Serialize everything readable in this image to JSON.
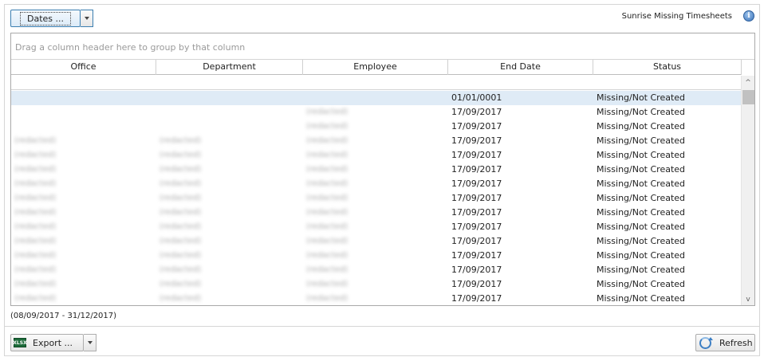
{
  "toolbar": {
    "dates_label": "Dates ...",
    "report_title": "Sunrise Missing Timesheets",
    "info_glyph": "i"
  },
  "grid": {
    "group_panel_hint": "Drag a column header here to group by that column",
    "columns": [
      "Office",
      "Department",
      "Employee",
      "End Date",
      "Status"
    ],
    "rows": [
      {
        "office": "",
        "department": "",
        "employee": "",
        "end_date": "01/01/0001",
        "status": "Missing/Not Created"
      },
      {
        "office": "",
        "department": "",
        "employee": "(redacted)",
        "end_date": "17/09/2017",
        "status": "Missing/Not Created"
      },
      {
        "office": "",
        "department": "",
        "employee": "(redacted)",
        "end_date": "17/09/2017",
        "status": "Missing/Not Created"
      },
      {
        "office": "(redacted)",
        "department": "(redacted)",
        "employee": "(redacted)",
        "end_date": "17/09/2017",
        "status": "Missing/Not Created"
      },
      {
        "office": "(redacted)",
        "department": "(redacted)",
        "employee": "(redacted)",
        "end_date": "17/09/2017",
        "status": "Missing/Not Created"
      },
      {
        "office": "(redacted)",
        "department": "(redacted)",
        "employee": "(redacted)",
        "end_date": "17/09/2017",
        "status": "Missing/Not Created"
      },
      {
        "office": "(redacted)",
        "department": "(redacted)",
        "employee": "(redacted)",
        "end_date": "17/09/2017",
        "status": "Missing/Not Created"
      },
      {
        "office": "(redacted)",
        "department": "(redacted)",
        "employee": "(redacted)",
        "end_date": "17/09/2017",
        "status": "Missing/Not Created"
      },
      {
        "office": "(redacted)",
        "department": "(redacted)",
        "employee": "(redacted)",
        "end_date": "17/09/2017",
        "status": "Missing/Not Created"
      },
      {
        "office": "(redacted)",
        "department": "(redacted)",
        "employee": "(redacted)",
        "end_date": "17/09/2017",
        "status": "Missing/Not Created"
      },
      {
        "office": "(redacted)",
        "department": "(redacted)",
        "employee": "(redacted)",
        "end_date": "17/09/2017",
        "status": "Missing/Not Created"
      },
      {
        "office": "(redacted)",
        "department": "(redacted)",
        "employee": "(redacted)",
        "end_date": "17/09/2017",
        "status": "Missing/Not Created"
      },
      {
        "office": "(redacted)",
        "department": "(redacted)",
        "employee": "(redacted)",
        "end_date": "17/09/2017",
        "status": "Missing/Not Created"
      },
      {
        "office": "(redacted)",
        "department": "(redacted)",
        "employee": "(redacted)",
        "end_date": "17/09/2017",
        "status": "Missing/Not Created"
      },
      {
        "office": "(redacted)",
        "department": "(redacted)",
        "employee": "(redacted)",
        "end_date": "17/09/2017",
        "status": "Missing/Not Created"
      }
    ],
    "selected_row": 0,
    "scroll_up_glyph": "^",
    "scroll_down_glyph": "v"
  },
  "footer": {
    "period": "(08/09/2017 - 31/12/2017)",
    "export_label": "Export ...",
    "export_icon_text": "XLSX",
    "refresh_label": "Refresh"
  },
  "colors": {
    "selected_row": "#dfebf6",
    "accent_border": "#3c7fb1",
    "info_icon": "#3a72b8",
    "excel_green": "#1d6b3a"
  },
  "icons": [
    "info-icon",
    "dropdown-arrow-icon",
    "excel-icon",
    "refresh-icon",
    "scroll-up-icon",
    "scroll-down-icon"
  ]
}
